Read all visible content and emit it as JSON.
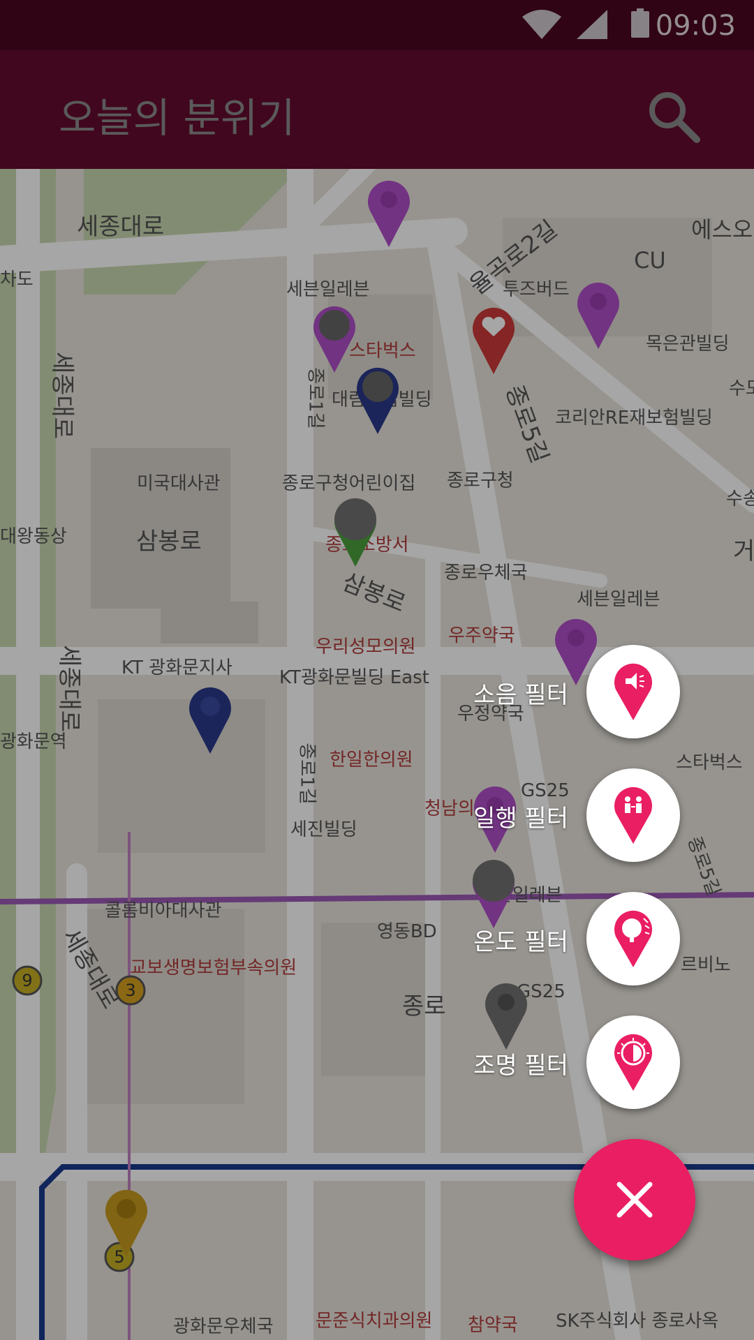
{
  "status_bar": {
    "time": "09:03"
  },
  "app_bar": {
    "title": "오늘의 분위기"
  },
  "map": {
    "labels": {
      "sejongdaero_top": "세종대로",
      "eulgokro2gil": "율곡로2길",
      "cu": "CU",
      "esso": "에스오",
      "chado": "차도",
      "seven_eleven_top": "세븐일레븐",
      "starbucks_top": "스타벅스",
      "twosome": "투즈버드",
      "mokeun": "목은관빌딩",
      "sejongdaero_left": "세종대로",
      "jongro1gil_top": "종로1길",
      "daelim": "대림산업빌딩",
      "jongro5gil_top": "종로5길",
      "korean_re": "코리안RE재보험빌딩",
      "us_embassy": "미국대사관",
      "jongro_daycare": "종로구청어린이집",
      "jongro_office": "종로구청",
      "daewang": "대왕동상",
      "sambongro": "삼봉로",
      "fire_station": "종로소방서",
      "sambongro2": "삼봉로",
      "jongro_post": "종로우체국",
      "seven_eleven_mid": "세븐일레븐",
      "woori_clinic": "우리성모의원",
      "woojoo_pharmacy": "우주약국",
      "kt_branch": "KT 광화문지사",
      "kt_east": "KT광화문빌딩 East",
      "sejongdaero_mid": "세종대로",
      "woojung": "우정약국",
      "gwanghwamun_station": "광화문역",
      "hanil_clinic": "한일한의원",
      "jongro1gil_bottom": "종로1길",
      "starbucks_right": "스타벅스",
      "chungnam": "청남의원",
      "gs25_mid": "GS25",
      "sejin": "세진빌딩",
      "jongro5gil_bottom": "종로5길",
      "seven_eleven_bottom": "세븐일레븐",
      "colombia": "콜롬비아대사관",
      "youngdong": "영동BD",
      "kyobo_clinic": "교보생명보험부속의원",
      "sejongdaero_bottom": "세종대로",
      "gs25_bottom": "GS25",
      "jongro": "종로",
      "rebino": "르비노",
      "gwanghwamun_post": "광화문우체국",
      "munjun": "문준식치과의원",
      "chamyak": "참약국",
      "sk": "SK주식회사 종로사옥",
      "line9": "9",
      "line3": "3",
      "line5": "5",
      "sudo": "수도",
      "sugo": "수송",
      "geo": "거"
    }
  },
  "fab_menu": {
    "items": [
      {
        "label": "소음 필터",
        "icon": "noise-pin-icon"
      },
      {
        "label": "일행 필터",
        "icon": "companion-pin-icon"
      },
      {
        "label": "온도 필터",
        "icon": "temperature-pin-icon"
      },
      {
        "label": "조명 필터",
        "icon": "light-pin-icon"
      }
    ],
    "close_icon": "close-icon"
  },
  "colors": {
    "accent": "#EA1E63",
    "app_bar": "#640C2E",
    "status_bar": "#4A0720"
  }
}
